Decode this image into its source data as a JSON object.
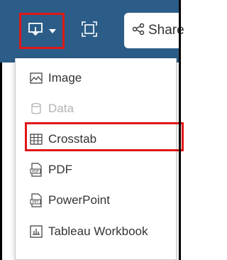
{
  "toolbar": {
    "download_icon": "download-icon",
    "dropdown_icon": "caret-down-icon",
    "fit_icon": "fit-to-window-icon",
    "share_icon": "share-icon",
    "share_label": "Share",
    "background_color": "#2b5d88",
    "highlight_color": "#e01818"
  },
  "download_menu": {
    "items": [
      {
        "label": "Image",
        "icon": "image-icon",
        "enabled": true
      },
      {
        "label": "Data",
        "icon": "database-icon",
        "enabled": false
      },
      {
        "label": "Crosstab",
        "icon": "crosstab-icon",
        "enabled": true,
        "highlighted": true
      },
      {
        "label": "PDF",
        "icon": "pdf-icon",
        "enabled": true
      },
      {
        "label": "PowerPoint",
        "icon": "powerpoint-icon",
        "enabled": true
      },
      {
        "label": "Tableau Workbook",
        "icon": "workbook-icon",
        "enabled": true
      }
    ]
  }
}
